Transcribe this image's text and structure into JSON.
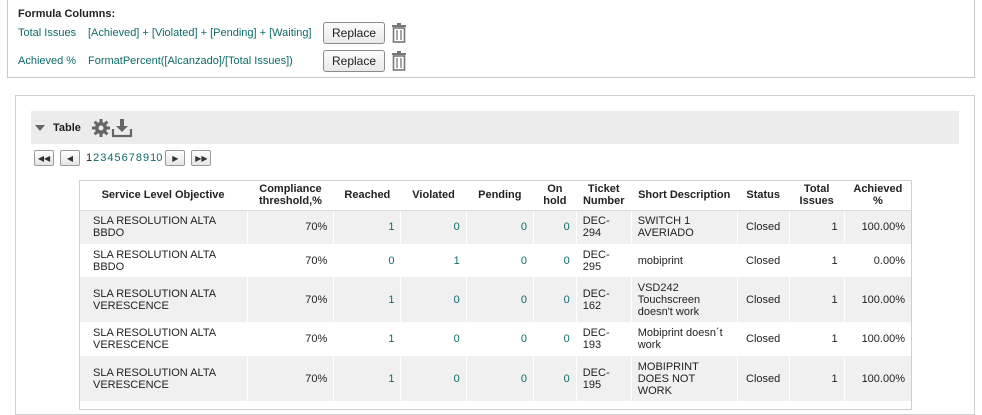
{
  "formula": {
    "title": "Formula Columns:",
    "rows": [
      {
        "name": "Total Issues",
        "expr": "[Achieved] + [Violated] + [Pending] + [Waiting]",
        "button": "Replace"
      },
      {
        "name": "Achieved %",
        "expr": "FormatPercent([Alcanzado]/[Total Issues])",
        "button": "Replace"
      }
    ]
  },
  "section": {
    "title": "Table"
  },
  "pager": {
    "pages": [
      "1",
      "2",
      "3",
      "4",
      "5",
      "6",
      "7",
      "8",
      "9",
      "10"
    ],
    "current": "1"
  },
  "table": {
    "headers": [
      "Service Level Objective",
      "Compliance threshold,%",
      "Reached",
      "Violated",
      "Pending",
      "On hold",
      "Ticket Number",
      "Short Description",
      "Status",
      "Total Issues",
      "Achieved %"
    ],
    "rows": [
      [
        "SLA RESOLUTION ALTA BBDO",
        "70%",
        "1",
        "0",
        "0",
        "0",
        "DEC-294",
        "SWITCH 1 AVERIADO",
        "Closed",
        "1",
        "100.00%"
      ],
      [
        "SLA RESOLUTION ALTA BBDO",
        "70%",
        "0",
        "1",
        "0",
        "0",
        "DEC-295",
        "mobiprint",
        "Closed",
        "1",
        "0.00%"
      ],
      [
        "SLA RESOLUTION ALTA VERESCENCE",
        "70%",
        "1",
        "0",
        "0",
        "0",
        "DEC-162",
        "VSD242 Touchscreen doesn't work",
        "Closed",
        "1",
        "100.00%"
      ],
      [
        "SLA RESOLUTION ALTA VERESCENCE",
        "70%",
        "1",
        "0",
        "0",
        "0",
        "DEC-193",
        "Mobiprint doesn´t work",
        "Closed",
        "1",
        "100.00%"
      ],
      [
        "SLA RESOLUTION ALTA VERESCENCE",
        "70%",
        "1",
        "0",
        "0",
        "0",
        "DEC-195",
        "MOBIPRINT DOES NOT WORK",
        "Closed",
        "1",
        "100.00%"
      ]
    ]
  },
  "icons": {
    "trash": "trash-icon",
    "gear": "gear-icon",
    "download": "download-icon",
    "first": "first-page-icon",
    "prev": "prev-page-icon",
    "next": "next-page-icon",
    "last": "last-page-icon",
    "collapse": "collapse-triangle-icon"
  },
  "colors": {
    "link": "#0f6a6a",
    "row_alt": "#f0f0f0"
  }
}
